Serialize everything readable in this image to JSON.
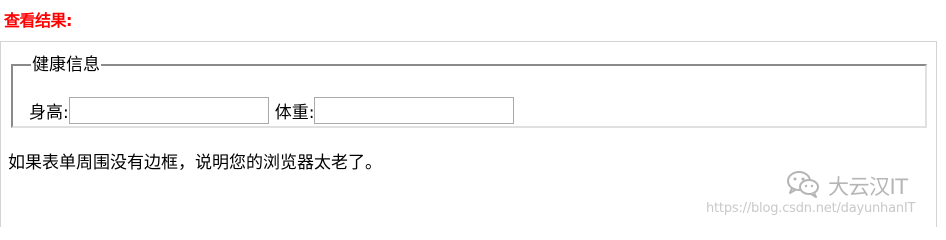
{
  "result_title": "查看结果:",
  "form": {
    "legend": "健康信息",
    "height_label": "身高:",
    "height_value": "",
    "weight_label": "体重:",
    "weight_value": ""
  },
  "note": "如果表单周围没有边框，说明您的浏览器太老了。",
  "watermark": {
    "brand": "大云汉IT",
    "icon": "wechat-icon",
    "url": "https://blog.csdn.net/dayunhanIT"
  }
}
